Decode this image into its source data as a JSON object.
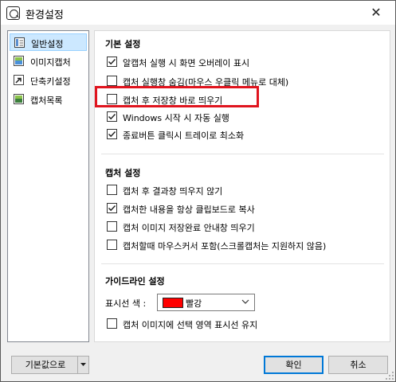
{
  "window": {
    "title": "환경설정",
    "close_glyph": "✕"
  },
  "sidebar": {
    "items": [
      {
        "label": "일반설정",
        "icon": "general-settings-icon",
        "selected": true
      },
      {
        "label": "이미지캡처",
        "icon": "image-capture-icon",
        "selected": false
      },
      {
        "label": "단축키설정",
        "icon": "shortcut-key-icon",
        "selected": false
      },
      {
        "label": "캡처목록",
        "icon": "capture-list-icon",
        "selected": false
      }
    ]
  },
  "sections": {
    "basic": {
      "title": "기본 설정",
      "options": [
        {
          "label": "알캡처 실행 시 화면 오버레이 표시",
          "checked": true
        },
        {
          "label": "캡처 실행창 숨김(마우스 우클릭 메뉴로 대체)",
          "checked": false
        },
        {
          "label": "캡처 후 저장창 바로 띄우기",
          "checked": false
        },
        {
          "label": "Windows 시작 시 자동 실행",
          "checked": true
        },
        {
          "label": "종료버튼 클릭시 트레이로 최소화",
          "checked": true
        }
      ]
    },
    "capture": {
      "title": "캡처 설정",
      "options": [
        {
          "label": "캡처 후 결과창 띄우지 않기",
          "checked": false
        },
        {
          "label": "캡처한 내용을 항상 클립보드로 복사",
          "checked": true
        },
        {
          "label": "캡처 이미지 저장완료 안내창 띄우기",
          "checked": false
        },
        {
          "label": "캡처할때 마우스커서 포함(스크롤캡처는 지원하지 않음)",
          "checked": false
        }
      ]
    },
    "guide": {
      "title": "가이드라인 설정",
      "color_label": "표시선 색 :",
      "color_value": "빨강",
      "color_hex": "#ff0000",
      "options": [
        {
          "label": "캡처 이미지에 선택 영역 표시선 유지",
          "checked": false
        }
      ]
    }
  },
  "buttons": {
    "defaults": "기본값으로",
    "ok": "확인",
    "cancel": "취소"
  },
  "colors": {
    "selection_bg": "#cce8ff",
    "highlight_border": "#e0141e",
    "accent": "#0078d7"
  }
}
